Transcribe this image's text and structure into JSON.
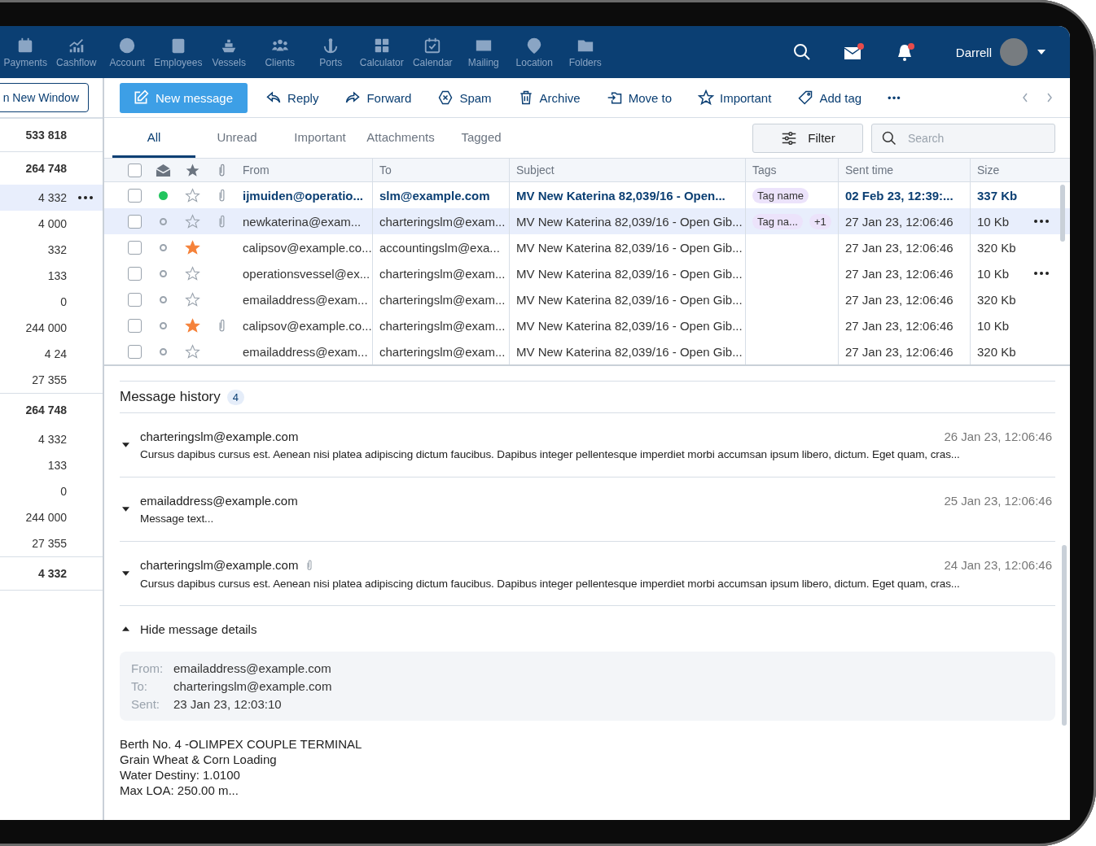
{
  "nav": {
    "items": [
      {
        "label": "Payments"
      },
      {
        "label": "Cashflow"
      },
      {
        "label": "Account"
      },
      {
        "label": "Employees"
      },
      {
        "label": "Vessels"
      },
      {
        "label": "Clients"
      },
      {
        "label": "Ports"
      },
      {
        "label": "Calculator"
      },
      {
        "label": "Calendar"
      },
      {
        "label": "Mailing"
      },
      {
        "label": "Location"
      },
      {
        "label": "Folders"
      }
    ],
    "mail_unread": true,
    "bell_unread": true,
    "user": {
      "name": "Darrell"
    }
  },
  "sidebar": {
    "button": "n New Window",
    "rows": [
      {
        "value": "533 818",
        "kind": "total",
        "selected": false,
        "menu": false
      },
      {
        "value": "264 748",
        "kind": "total",
        "selected": false,
        "menu": false
      },
      {
        "value": "4 332",
        "kind": "item",
        "selected": true,
        "menu": true
      },
      {
        "value": "4 000",
        "kind": "item",
        "selected": false,
        "menu": false
      },
      {
        "value": "332",
        "kind": "item",
        "selected": false,
        "menu": false
      },
      {
        "value": "133",
        "kind": "item",
        "selected": false,
        "menu": false
      },
      {
        "value": "0",
        "kind": "item",
        "selected": false,
        "menu": false
      },
      {
        "value": "244 000",
        "kind": "item",
        "selected": false,
        "menu": false
      },
      {
        "value": "4 24",
        "kind": "item",
        "selected": false,
        "menu": false
      },
      {
        "value": "27 355",
        "kind": "item",
        "selected": false,
        "menu": false
      },
      {
        "value": "264 748",
        "kind": "total",
        "selected": false,
        "menu": false
      },
      {
        "value": "4 332",
        "kind": "item",
        "selected": false,
        "menu": false
      },
      {
        "value": "133",
        "kind": "item",
        "selected": false,
        "menu": false
      },
      {
        "value": "0",
        "kind": "item",
        "selected": false,
        "menu": false
      },
      {
        "value": "244 000",
        "kind": "item",
        "selected": false,
        "menu": false
      },
      {
        "value": "27 355",
        "kind": "item",
        "selected": false,
        "menu": false
      },
      {
        "value": "4 332",
        "kind": "total",
        "selected": false,
        "menu": false
      }
    ]
  },
  "toolbar": {
    "primary": "New message",
    "actions": [
      {
        "label": "Reply"
      },
      {
        "label": "Forward"
      },
      {
        "label": "Spam"
      },
      {
        "label": "Archive"
      },
      {
        "label": "Move to"
      },
      {
        "label": "Important"
      },
      {
        "label": "Add tag"
      }
    ],
    "more": "•••"
  },
  "tabs": [
    {
      "label": "All",
      "selected": true
    },
    {
      "label": "Unread",
      "selected": false
    },
    {
      "label": "Important",
      "selected": false
    },
    {
      "label": "Attachments",
      "selected": false
    },
    {
      "label": "Tagged",
      "selected": false
    }
  ],
  "select_all_checked": false,
  "filter": "Filter",
  "search": {
    "placeholder": "Search"
  },
  "table": {
    "columns": [
      "From",
      "To",
      "Subject",
      "Tags",
      "Sent time",
      "Size"
    ],
    "rows": [
      {
        "checked": false,
        "unread": true,
        "starred": false,
        "attachment": true,
        "selected": false,
        "menu": false,
        "from": "ijmuiden@operatio...",
        "to": "slm@example.com",
        "subject": "MV New Katerina 82,039/16 - Open...",
        "tags": [
          "Tag name"
        ],
        "sent": "02 Feb 23, 12:39:...",
        "size": "337 Kb"
      },
      {
        "checked": false,
        "unread": false,
        "starred": false,
        "attachment": true,
        "selected": true,
        "menu": true,
        "from": "newkaterina@exam...",
        "to": "charteringslm@exam...",
        "subject": "MV New Katerina 82,039/16 - Open Gib...",
        "tags": [
          "Tag na...",
          "+1"
        ],
        "sent": "27 Jan 23, 12:06:46",
        "size": "10 Kb"
      },
      {
        "checked": false,
        "unread": false,
        "starred": true,
        "attachment": false,
        "selected": false,
        "menu": false,
        "from": "calipsov@example.co...",
        "to": "accountingslm@exa...",
        "subject": "MV New Katerina 82,039/16 - Open Gib...",
        "tags": [],
        "sent": "27 Jan 23, 12:06:46",
        "size": "320 Kb"
      },
      {
        "checked": false,
        "unread": false,
        "starred": false,
        "attachment": false,
        "selected": false,
        "menu": true,
        "from": "operationsvessel@ex...",
        "to": "charteringslm@exam...",
        "subject": "MV New Katerina 82,039/16 - Open Gib...",
        "tags": [],
        "sent": "27 Jan 23, 12:06:46",
        "size": "10 Kb"
      },
      {
        "checked": false,
        "unread": false,
        "starred": false,
        "attachment": false,
        "selected": false,
        "menu": false,
        "from": "emailaddress@exam...",
        "to": "charteringslm@exam...",
        "subject": "MV New Katerina 82,039/16 - Open Gib...",
        "tags": [],
        "sent": "27 Jan 23, 12:06:46",
        "size": "320 Kb"
      },
      {
        "checked": false,
        "unread": false,
        "starred": true,
        "attachment": true,
        "selected": false,
        "menu": false,
        "from": "calipsov@example.co...",
        "to": "charteringslm@exam...",
        "subject": "MV New Katerina 82,039/16 - Open Gib...",
        "tags": [],
        "sent": "27 Jan 23, 12:06:46",
        "size": "10 Kb"
      },
      {
        "checked": false,
        "unread": false,
        "starred": false,
        "attachment": false,
        "selected": false,
        "menu": false,
        "from": "emailaddress@exam...",
        "to": "charteringslm@exam...",
        "subject": "MV New Katerina 82,039/16 - Open Gib...",
        "tags": [],
        "sent": "27 Jan 23, 12:06:46",
        "size": "320 Kb"
      }
    ]
  },
  "history": {
    "title": "Message history",
    "count": "4",
    "messages": [
      {
        "from": "charteringslm@example.com",
        "date": "26 Jan 23, 12:06:46",
        "text": "Cursus dapibus cursus est. Aenean nisi platea adipiscing dictum faucibus. Dapibus integer pellentesque imperdiet morbi accumsan ipsum libero, dictum. Eget quam, cras...",
        "attachment": false
      },
      {
        "from": "emailaddress@example.com",
        "date": "25 Jan 23, 12:06:46",
        "text": "Message text...",
        "attachment": false
      },
      {
        "from": "charteringslm@example.com",
        "date": "24 Jan 23, 12:06:46",
        "text": "Cursus dapibus cursus est. Aenean nisi platea adipiscing dictum faucibus. Dapibus integer pellentesque imperdiet morbi accumsan ipsum libero, dictum. Eget quam, cras...",
        "attachment": true
      }
    ],
    "details_toggle": "Hide message details",
    "details_expanded": true,
    "details": [
      {
        "label": "From:",
        "value": "emailaddress@example.com"
      },
      {
        "label": "To:",
        "value": "charteringslm@example.com"
      },
      {
        "label": "Sent:",
        "value": "23 Jan 23, 12:03:10"
      }
    ],
    "body": [
      "Berth No. 4 -OLIMPEX COUPLE TERMINAL",
      "Grain Wheat & Corn Loading",
      "Water Destiny: 1.0100",
      "Max LOA: 250.00 m..."
    ]
  }
}
